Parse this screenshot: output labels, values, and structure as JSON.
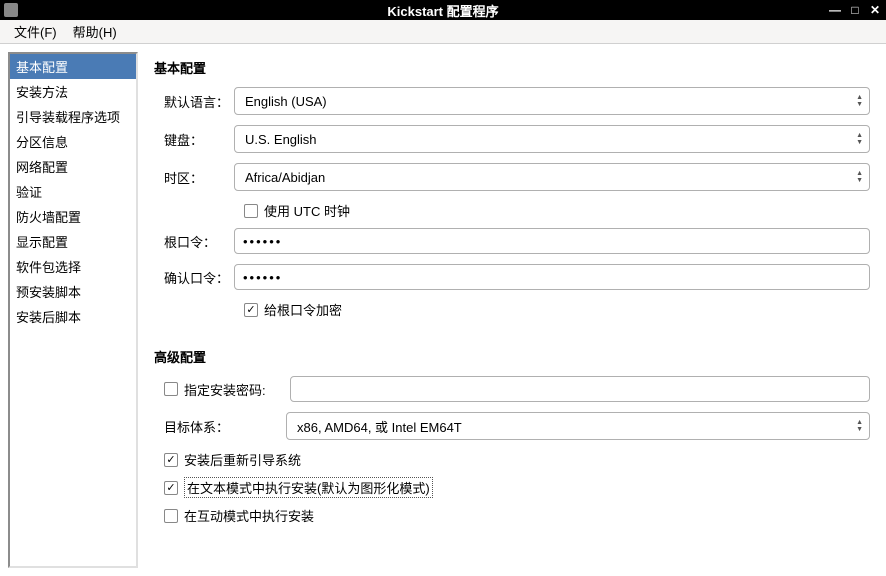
{
  "window": {
    "title": "Kickstart 配置程序"
  },
  "menubar": {
    "file": "文件(F)",
    "help": "帮助(H)"
  },
  "sidebar": {
    "items": [
      "基本配置",
      "安装方法",
      "引导装载程序选项",
      "分区信息",
      "网络配置",
      "验证",
      "防火墙配置",
      "显示配置",
      "软件包选择",
      "预安装脚本",
      "安装后脚本"
    ],
    "selected_index": 0
  },
  "basic": {
    "section_title": "基本配置",
    "default_lang_label": "默认语言：",
    "default_lang_value": "English (USA)",
    "keyboard_label": "键盘：",
    "keyboard_value": "U.S. English",
    "timezone_label": "时区：",
    "timezone_value": "Africa/Abidjan",
    "use_utc_label": "使用 UTC 时钟",
    "use_utc_checked": false,
    "root_pw_label": "根口令：",
    "root_pw_value": "••••••",
    "confirm_pw_label": "确认口令：",
    "confirm_pw_value": "••••••",
    "encrypt_root_label": "给根口令加密",
    "encrypt_root_checked": true
  },
  "advanced": {
    "section_title": "高级配置",
    "specify_pw_label": "指定安装密码:",
    "specify_pw_checked": false,
    "specify_pw_value": "",
    "target_arch_label": "目标体系：",
    "target_arch_value": "x86, AMD64, 或 Intel EM64T",
    "reboot_label": "安装后重新引导系统",
    "reboot_checked": true,
    "text_mode_label": "在文本模式中执行安装(默认为图形化模式)",
    "text_mode_checked": true,
    "interactive_label": "在互动模式中执行安装",
    "interactive_checked": false
  }
}
